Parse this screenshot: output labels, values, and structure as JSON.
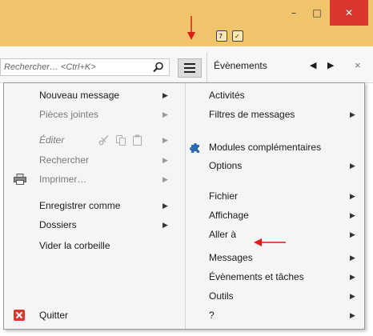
{
  "window": {
    "minimize_glyph": "–",
    "maximize_glyph": "□",
    "close_glyph": "✕",
    "titlebar_color": "#f0c46a",
    "close_color": "#d9372f"
  },
  "toolbar": {
    "search": {
      "placeholder": "Rechercher… <Ctrl+K>"
    },
    "events_pane": {
      "title": "Évènements",
      "prev_glyph": "◀",
      "next_glyph": "▶",
      "close_glyph": "×"
    }
  },
  "left_menu": {
    "items": [
      {
        "label": "Nouveau message",
        "submenu": true,
        "disabled": false
      },
      {
        "label": "Pièces jointes",
        "submenu": true,
        "disabled": true
      },
      {
        "label": "Éditer",
        "submenu": true,
        "disabled": true,
        "icons": [
          "cut-icon",
          "copy-icon",
          "paste-icon"
        ]
      },
      {
        "label": "Rechercher",
        "submenu": true,
        "disabled": true
      },
      {
        "label": "Imprimer…",
        "submenu": true,
        "disabled": true,
        "icon": "printer-icon"
      },
      {
        "label": "Enregistrer comme",
        "submenu": true,
        "disabled": false
      },
      {
        "label": "Dossiers",
        "submenu": true,
        "disabled": false
      },
      {
        "label": "Vider la corbeille",
        "submenu": false,
        "disabled": false
      }
    ],
    "quit": {
      "label": "Quitter",
      "icon": "quit-icon"
    }
  },
  "right_menu": {
    "items": [
      {
        "label": "Activités",
        "submenu": false
      },
      {
        "label": "Filtres de messages",
        "submenu": true
      },
      {
        "label": "Modules complémentaires",
        "submenu": false,
        "icon": "puzzle-icon"
      },
      {
        "label": "Options",
        "submenu": true
      },
      {
        "label": "Fichier",
        "submenu": true
      },
      {
        "label": "Affichage",
        "submenu": true
      },
      {
        "label": "Aller à",
        "submenu": true
      },
      {
        "label": "Messages",
        "submenu": true
      },
      {
        "label": "Évènements et tâches",
        "submenu": true
      },
      {
        "label": "Outils",
        "submenu": true
      },
      {
        "label": "?",
        "submenu": true
      }
    ]
  },
  "annotation_color": "#e01b1b"
}
